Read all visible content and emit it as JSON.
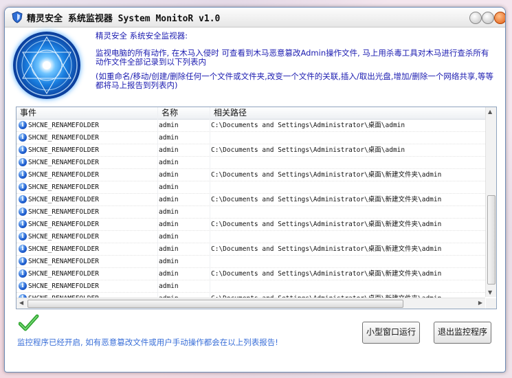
{
  "window": {
    "title": "精灵安全  系统监视器  System MonitoR v1.0"
  },
  "intro": {
    "title": "精灵安全  系统安全监视器:",
    "para1": "监视电脑的所有动作, 在木马入侵时 可查看到木马恶意篡改Admin操作文件, 马上用杀毒工具对木马进行查杀所有动作文件全部记录到以下列表内",
    "para2": "(如重命名/移动/创建/删除任何一个文件或文件夹,改变一个文件的关联,插入/取出光盘,增加/删除一个网络共享,等等都将马上报告到列表内)"
  },
  "table": {
    "columns": [
      "事件",
      "名称",
      "相关路径"
    ],
    "rows": [
      {
        "event": "SHCNE_RENAMEFOLDER",
        "name": "admin",
        "path": "C:\\Documents and Settings\\Administrator\\桌面\\admin"
      },
      {
        "event": "SHCNE_RENAMEFOLDER",
        "name": "admin",
        "path": ""
      },
      {
        "event": "SHCNE_RENAMEFOLDER",
        "name": "admin",
        "path": "C:\\Documents and Settings\\Administrator\\桌面\\admin"
      },
      {
        "event": "SHCNE_RENAMEFOLDER",
        "name": "admin",
        "path": ""
      },
      {
        "event": "SHCNE_RENAMEFOLDER",
        "name": "admin",
        "path": "C:\\Documents and Settings\\Administrator\\桌面\\新建文件夹\\admin"
      },
      {
        "event": "SHCNE_RENAMEFOLDER",
        "name": "admin",
        "path": ""
      },
      {
        "event": "SHCNE_RENAMEFOLDER",
        "name": "admin",
        "path": "C:\\Documents and Settings\\Administrator\\桌面\\新建文件夹\\admin"
      },
      {
        "event": "SHCNE_RENAMEFOLDER",
        "name": "admin",
        "path": ""
      },
      {
        "event": "SHCNE_RENAMEFOLDER",
        "name": "admin",
        "path": "C:\\Documents and Settings\\Administrator\\桌面\\新建文件夹\\admin"
      },
      {
        "event": "SHCNE_RENAMEFOLDER",
        "name": "admin",
        "path": ""
      },
      {
        "event": "SHCNE_RENAMEFOLDER",
        "name": "admin",
        "path": "C:\\Documents and Settings\\Administrator\\桌面\\新建文件夹\\admin"
      },
      {
        "event": "SHCNE_RENAMEFOLDER",
        "name": "admin",
        "path": ""
      },
      {
        "event": "SHCNE_RENAMEFOLDER",
        "name": "admin",
        "path": "C:\\Documents and Settings\\Administrator\\桌面\\新建文件夹\\admin"
      },
      {
        "event": "SHCNE_RENAMEFOLDER",
        "name": "admin",
        "path": ""
      },
      {
        "event": "SHCNE_RENAMEFOLDER",
        "name": "admin",
        "path": "C:\\Documents and Settings\\Administrator\\桌面\\新建文件夹\\admin"
      }
    ],
    "row_icon": "info-icon"
  },
  "footer": {
    "status": "监控程序已经开启, 如有恶意篡改文件或用户手动操作都会在以上列表报告!",
    "status_icon": "checkmark-icon",
    "mini_button": "小型窗口运行",
    "exit_button": "退出监控程序"
  },
  "colors": {
    "intro_text": "#1b1bb0",
    "status_text": "#3a6fd8",
    "close_button": "#e25b10",
    "check": "#2fa52f"
  }
}
